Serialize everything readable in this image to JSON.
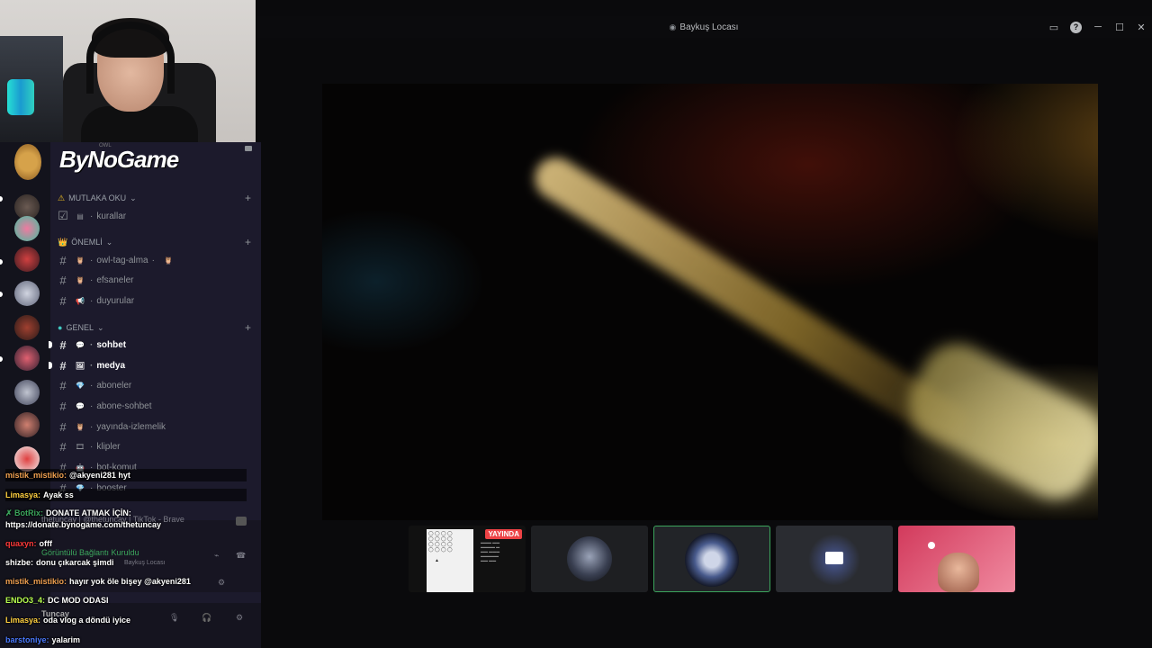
{
  "window": {
    "title": "Baykuş Locası",
    "controls": {
      "inbox": "▭",
      "help": "?",
      "minimize": "─",
      "maximize": "☐",
      "close": "✕"
    }
  },
  "thumbnails": {
    "live_badge": "YAYINDA"
  },
  "server": {
    "logo_text": "ByNoGame",
    "banner_small": "OWL"
  },
  "categories": [
    {
      "name": "MUTLAKA OKU",
      "icon": "⚠"
    },
    {
      "name": "ÖNEMLİ",
      "icon": "👑"
    },
    {
      "name": "GENEL",
      "icon": "●"
    }
  ],
  "channels": [
    {
      "name": "kurallar",
      "emoji": "▤"
    },
    {
      "name": "owl-tag-alma",
      "emoji": "🦉"
    },
    {
      "name": "efsaneler",
      "emoji": "🦉"
    },
    {
      "name": "duyurular",
      "emoji": "📢"
    },
    {
      "name": "sohbet",
      "emoji": "💬"
    },
    {
      "name": "medya",
      "emoji": "🖼"
    },
    {
      "name": "aboneler",
      "emoji": "💎"
    },
    {
      "name": "abone-sohbet",
      "emoji": "💬"
    },
    {
      "name": "yayında-izlemelik",
      "emoji": "🦉"
    },
    {
      "name": "klipler",
      "emoji": "🎞"
    },
    {
      "name": "bot-komut",
      "emoji": "🤖"
    },
    {
      "name": "booster",
      "emoji": "💎"
    }
  ],
  "voice": {
    "tab_text": "thetuncay | @thetuncay | TikTok - Brave",
    "status": "Görüntülü Bağlantı Kuruldu",
    "channel": "Baykuş Locası",
    "username": "Tuncay"
  },
  "chat": [
    {
      "user": "mistik_mistikio:",
      "text": "@akyeni281 hyt",
      "color": "#f0a050"
    },
    {
      "user": "Limasya:",
      "text": "Ayak ss",
      "color": "#ffd040"
    },
    {
      "user": "✗ BotRix:",
      "text": "DONATE ATMAK İÇİN:",
      "color": "#3ba55c"
    },
    {
      "user": "",
      "text": "https://donate.bynogame.com/thetuncay",
      "color": "#ffffff"
    },
    {
      "user": "quaxyn:",
      "text": "offf",
      "color": "#ff3a3a"
    },
    {
      "user": "shizbe:",
      "text": "donu çıkarcak şimdi",
      "color": "#ffffff"
    },
    {
      "user": "mistik_mistikio:",
      "text": "hayır yok öle bişey @akyeni281",
      "color": "#f0a050"
    },
    {
      "user": "ENDO3_4:",
      "text": "DC MOD ODASI",
      "color": "#b8ff50"
    },
    {
      "user": "Limasya:",
      "text": "oda vlog a döndü iyice",
      "color": "#ffd040"
    },
    {
      "user": "barstoniye:",
      "text": "yalarim",
      "color": "#4a7aff"
    }
  ]
}
